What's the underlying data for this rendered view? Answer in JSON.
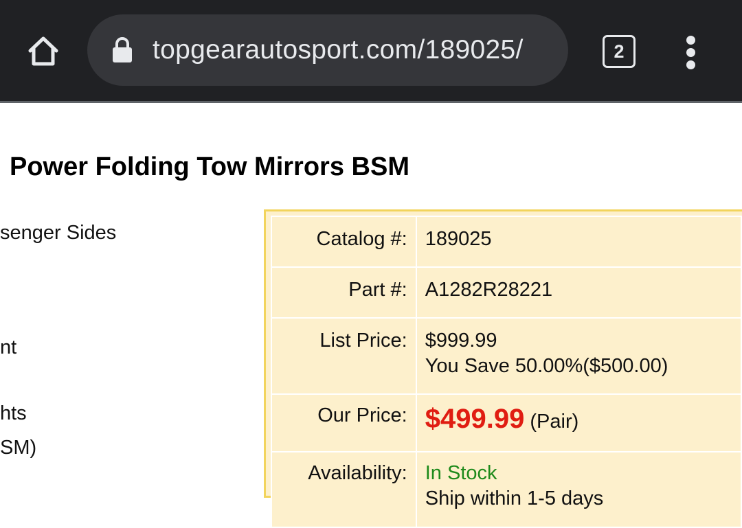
{
  "browser": {
    "url": "topgearautosport.com/189025/",
    "tab_count": "2",
    "icons": {
      "home": "home-icon",
      "lock": "lock-icon",
      "tabs": "tab-switcher-icon",
      "menu": "more-vert-icon"
    }
  },
  "product": {
    "title": "Power Folding Tow Mirrors BSM",
    "feature_fragments": [
      "senger Sides",
      "nt",
      "hts",
      "SM)"
    ]
  },
  "info": {
    "catalog_label": "Catalog #:",
    "catalog_value": "189025",
    "part_label": "Part #:",
    "part_value": "A1282R28221",
    "list_label": "List Price:",
    "list_value": "$999.99",
    "savings": "You Save 50.00%($500.00)",
    "our_label": "Our Price:",
    "our_value": "$499.99",
    "our_unit": "(Pair)",
    "availability_label": "Availability:",
    "availability_value": "In Stock",
    "shipping": "Ship within 1-5 days"
  },
  "colors": {
    "toolbar": "#202124",
    "omnibox": "#35363a",
    "price_red": "#e01d12",
    "stock_green": "#1e8a1b",
    "box_fill": "#fdf0cc",
    "box_border": "#f2d45c"
  }
}
